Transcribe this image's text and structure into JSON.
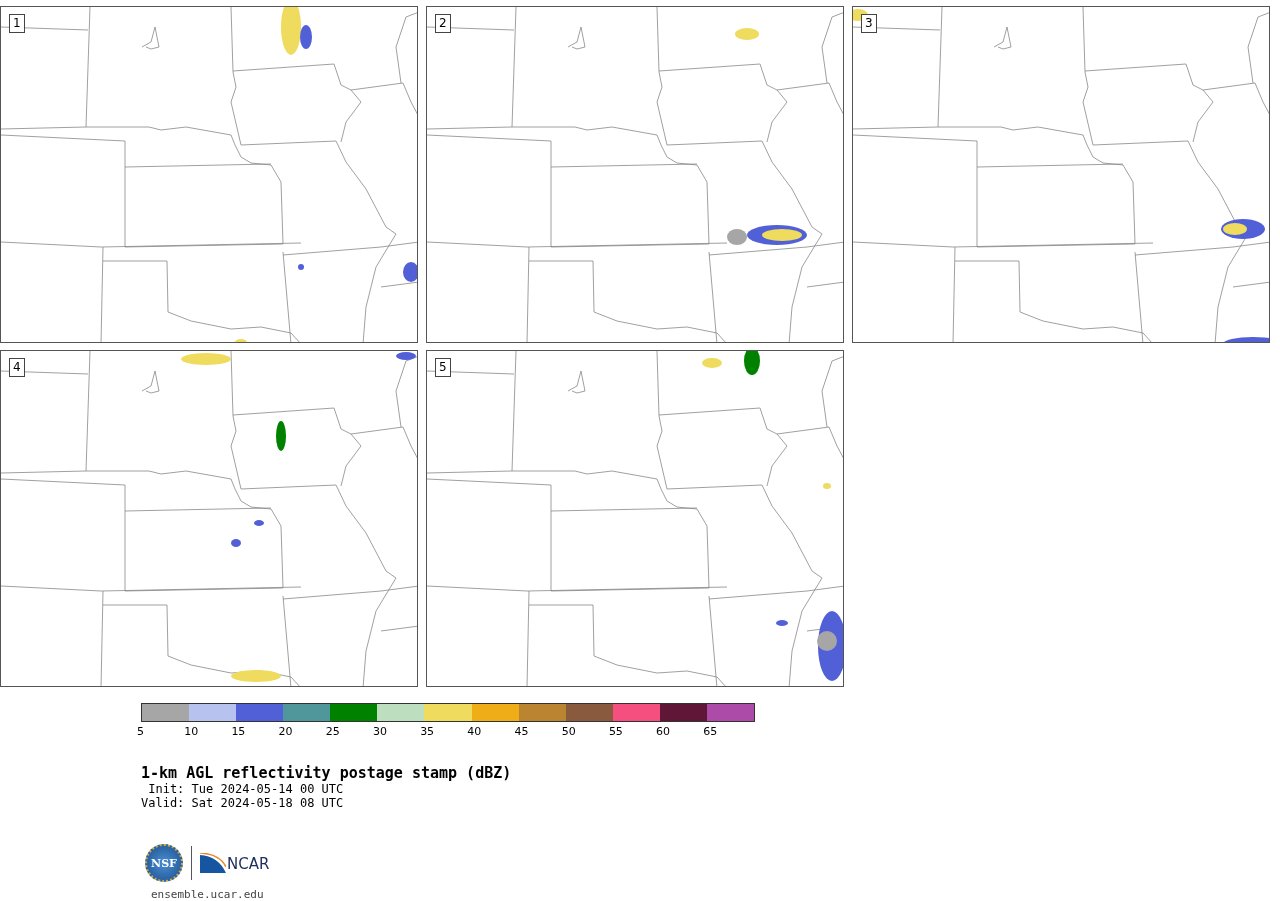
{
  "panels": [
    {
      "number": "1"
    },
    {
      "number": "2"
    },
    {
      "number": "3"
    },
    {
      "number": "4"
    },
    {
      "number": "5"
    }
  ],
  "colorbar": {
    "bins": [
      {
        "color": "#a6a6a6"
      },
      {
        "color": "#b7c3ee"
      },
      {
        "color": "#5160d6"
      },
      {
        "color": "#4f979b"
      },
      {
        "color": "#008200"
      },
      {
        "color": "#bedfbf"
      },
      {
        "color": "#efdb5e"
      },
      {
        "color": "#efad17"
      },
      {
        "color": "#bb8431"
      },
      {
        "color": "#8a5a3e"
      },
      {
        "color": "#f44f7e"
      },
      {
        "color": "#601636"
      },
      {
        "color": "#ad4ba8"
      }
    ],
    "ticks": [
      "5",
      "10",
      "15",
      "20",
      "25",
      "30",
      "35",
      "40",
      "45",
      "50",
      "55",
      "60",
      "65"
    ]
  },
  "title": "1-km AGL reflectivity postage stamp (dBZ)",
  "init": " Init: Tue 2024-05-14 00 UTC",
  "valid": "Valid: Sat 2024-05-18 08 UTC",
  "logos": {
    "nsf": "NSF",
    "ncar": "NCAR"
  },
  "site": "ensemble.ucar.edu"
}
